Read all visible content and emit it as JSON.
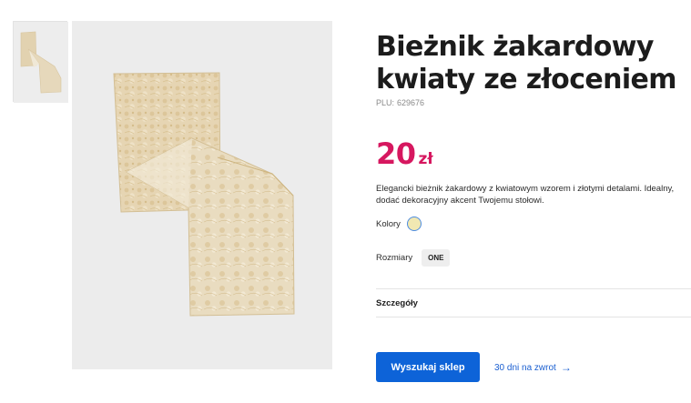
{
  "product": {
    "title_line1": "Bieżnik żakardowy",
    "title_line2": "kwiaty ze złoceniem",
    "plu_label": "PLU:",
    "plu_value": "629676",
    "price_amount": "20",
    "price_currency": "zł",
    "price_color": "#d6175f",
    "description": "Elegancki bieżnik żakardowy z kwiatowym wzorem i złotymi detalami. Idealny, dodać dekoracyjny akcent Twojemu stołowi."
  },
  "options": {
    "colors_label": "Kolory",
    "color_swatch": "#f1e8b2",
    "sizes_label": "Rozmiary",
    "size_value": "ONE"
  },
  "details": {
    "label": "Szczegóły"
  },
  "actions": {
    "find_store_label": "Wyszukaj sklep",
    "find_store_color": "#0d63d8",
    "return_label": "30 dni na zwrot",
    "return_icon": "arrow-right-icon"
  }
}
